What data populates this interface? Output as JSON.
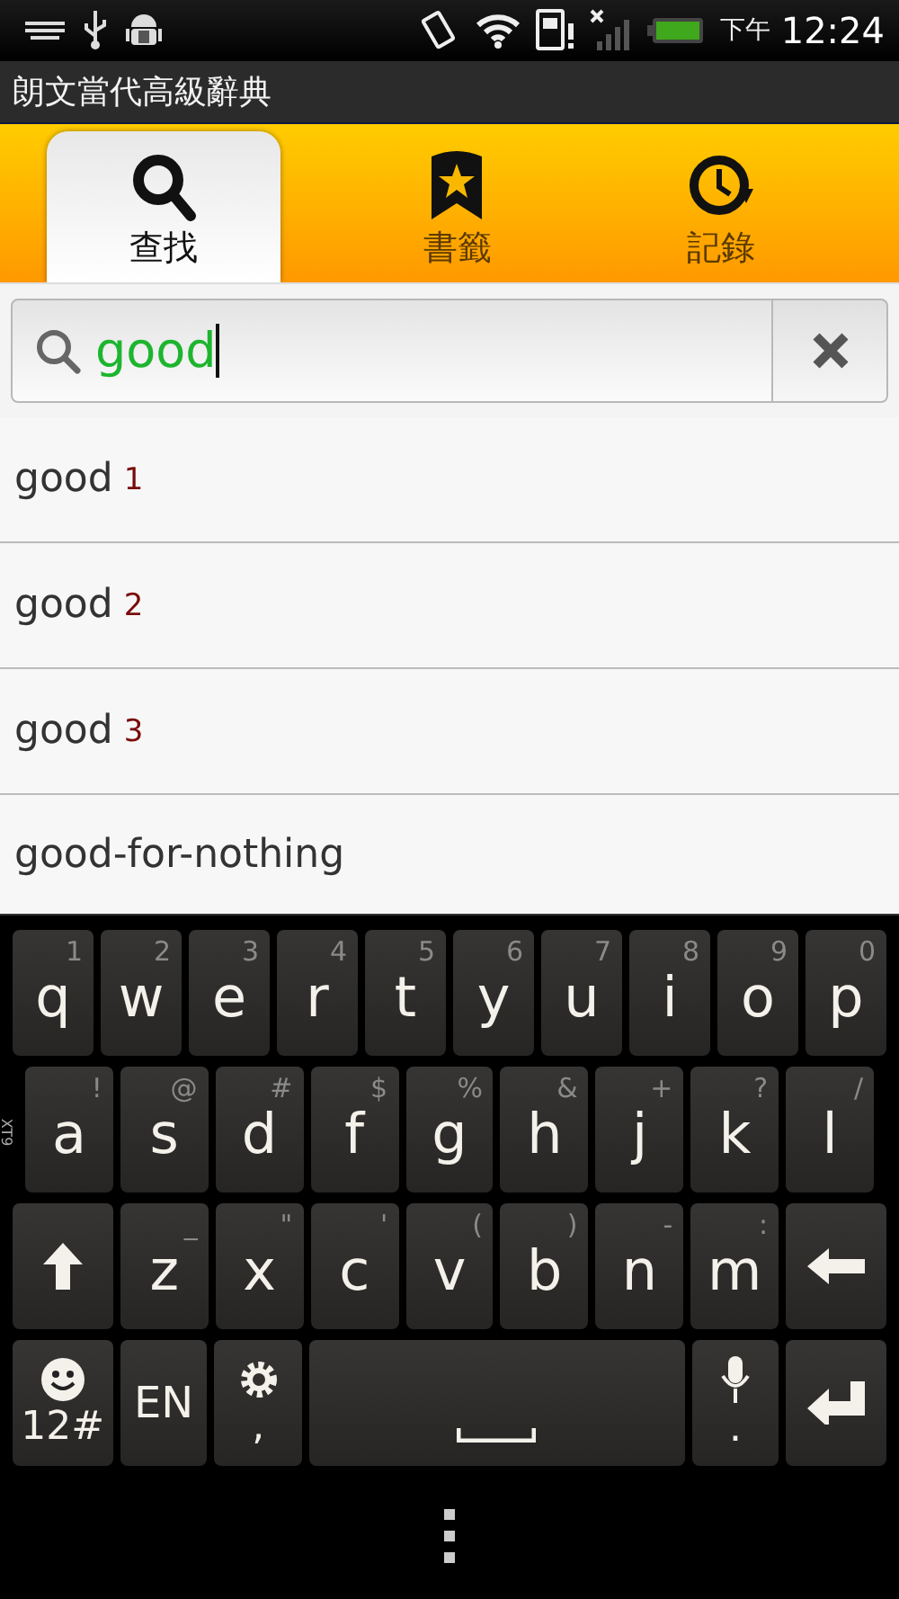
{
  "status_bar": {
    "period": "下午",
    "time": "12:24"
  },
  "app_title": "朗文當代高級辭典",
  "tabs": [
    {
      "label": "查找",
      "kind": "search",
      "selected": true
    },
    {
      "label": "書籤",
      "kind": "bookmark",
      "selected": false
    },
    {
      "label": "記錄",
      "kind": "history",
      "selected": false
    }
  ],
  "search": {
    "value": "good"
  },
  "results": [
    {
      "word": "good",
      "superscript": "1"
    },
    {
      "word": "good",
      "superscript": "2"
    },
    {
      "word": "good",
      "superscript": "3"
    },
    {
      "word": "good-for-nothing"
    }
  ],
  "keyboard": {
    "mode_label": "XT9",
    "rows": [
      {
        "keys": [
          {
            "kind": "letter",
            "main": "q",
            "alt": "1"
          },
          {
            "kind": "letter",
            "main": "w",
            "alt": "2"
          },
          {
            "kind": "letter",
            "main": "e",
            "alt": "3"
          },
          {
            "kind": "letter",
            "main": "r",
            "alt": "4"
          },
          {
            "kind": "letter",
            "main": "t",
            "alt": "5"
          },
          {
            "kind": "letter",
            "main": "y",
            "alt": "6"
          },
          {
            "kind": "letter",
            "main": "u",
            "alt": "7"
          },
          {
            "kind": "letter",
            "main": "i",
            "alt": "8"
          },
          {
            "kind": "letter",
            "main": "o",
            "alt": "9"
          },
          {
            "kind": "letter",
            "main": "p",
            "alt": "0"
          }
        ]
      },
      {
        "keys": [
          {
            "kind": "letter",
            "main": "a",
            "alt": "!"
          },
          {
            "kind": "letter",
            "main": "s",
            "alt": "@"
          },
          {
            "kind": "letter",
            "main": "d",
            "alt": "#"
          },
          {
            "kind": "letter",
            "main": "f",
            "alt": "$"
          },
          {
            "kind": "letter",
            "main": "g",
            "alt": "%"
          },
          {
            "kind": "letter",
            "main": "h",
            "alt": "&"
          },
          {
            "kind": "letter",
            "main": "j",
            "alt": "+"
          },
          {
            "kind": "letter",
            "main": "k",
            "alt": "?"
          },
          {
            "kind": "letter",
            "main": "l",
            "alt": "/"
          }
        ]
      },
      {
        "keys": [
          {
            "kind": "shift"
          },
          {
            "kind": "letter",
            "main": "z",
            "alt": "_"
          },
          {
            "kind": "letter",
            "main": "x",
            "alt": "\""
          },
          {
            "kind": "letter",
            "main": "c",
            "alt": "'"
          },
          {
            "kind": "letter",
            "main": "v",
            "alt": "("
          },
          {
            "kind": "letter",
            "main": "b",
            "alt": ")"
          },
          {
            "kind": "letter",
            "main": "n",
            "alt": "-"
          },
          {
            "kind": "letter",
            "main": "m",
            "alt": ":"
          },
          {
            "kind": "backspace"
          }
        ]
      },
      {
        "keys": [
          {
            "kind": "symbols",
            "main": "12#"
          },
          {
            "kind": "lang",
            "main": "EN"
          },
          {
            "kind": "comma",
            "main": ","
          },
          {
            "kind": "space"
          },
          {
            "kind": "period",
            "main": "."
          },
          {
            "kind": "enter"
          }
        ]
      }
    ]
  }
}
